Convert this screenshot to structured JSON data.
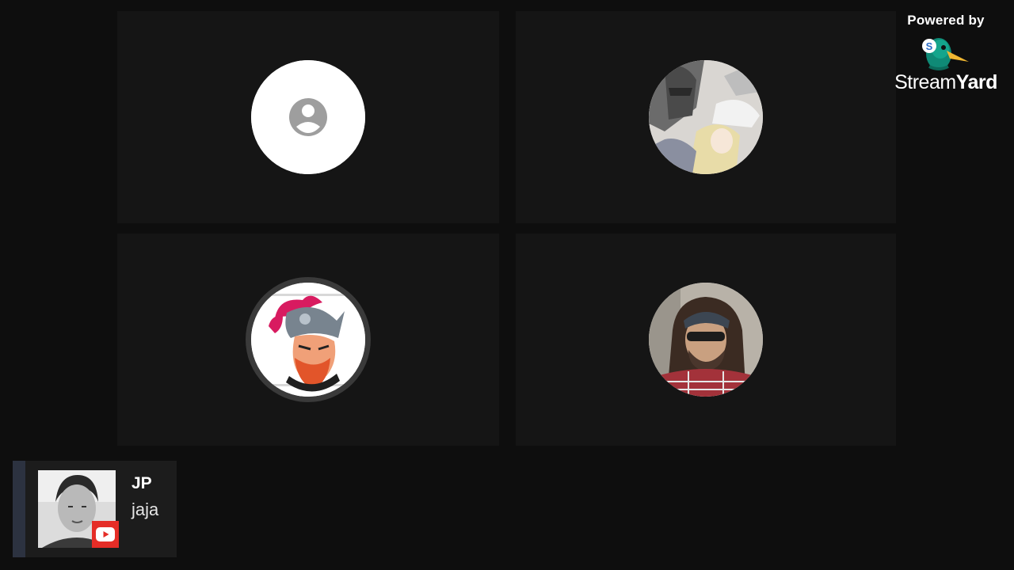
{
  "branding": {
    "powered_by": "Powered by",
    "brand_light": "Stream",
    "brand_bold": "Yard"
  },
  "participants": [
    {
      "avatar": "default-person-icon"
    },
    {
      "avatar": "anime-artwork-avatar"
    },
    {
      "avatar": "knight-helmet-logo-avatar"
    },
    {
      "avatar": "man-with-bandana-avatar"
    }
  ],
  "banner": {
    "name": "JP",
    "message": "jaja",
    "platform_icon": "youtube-icon"
  },
  "colors": {
    "background": "#0e0e0e",
    "tile": "#151515",
    "youtube_red": "#e52d27",
    "banner_accent": "#2c3240"
  }
}
